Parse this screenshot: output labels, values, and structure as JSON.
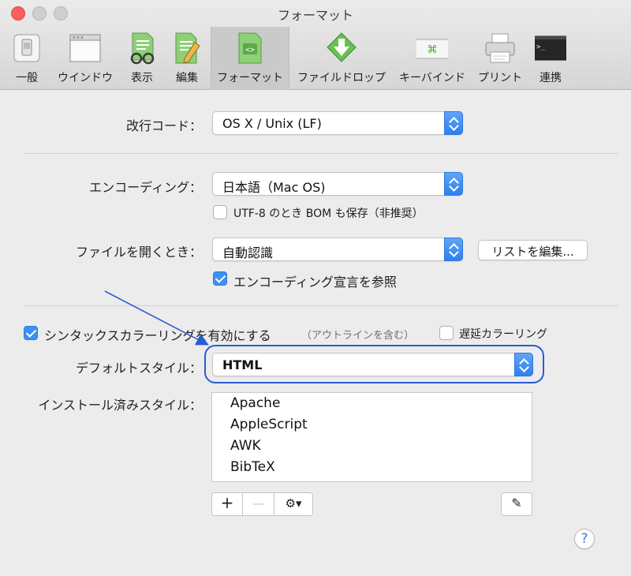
{
  "window": {
    "title": "フォーマット"
  },
  "toolbar": {
    "items": [
      {
        "label": "一般",
        "icon": "general-icon"
      },
      {
        "label": "ウインドウ",
        "icon": "window-icon"
      },
      {
        "label": "表示",
        "icon": "view-icon"
      },
      {
        "label": "編集",
        "icon": "edit-icon"
      },
      {
        "label": "フォーマット",
        "icon": "format-icon",
        "selected": true
      },
      {
        "label": "ファイルドロップ",
        "icon": "file-drop-icon"
      },
      {
        "label": "キーバインド",
        "icon": "key-binding-icon"
      },
      {
        "label": "プリント",
        "icon": "print-icon"
      },
      {
        "label": "連携",
        "icon": "terminal-icon"
      }
    ],
    "key_glyph": "⌘",
    "terminal_prompt": ">_"
  },
  "line_ending": {
    "label": "改行コード：",
    "value": "OS X / Unix (LF)"
  },
  "encoding": {
    "label": "エンコーディング：",
    "value": "日本語（Mac OS)",
    "bom_label": "UTF-8 のとき BOM も保存（非推奨）",
    "bom_checked": false
  },
  "open_file": {
    "label": "ファイルを開くとき：",
    "value": "自動認識",
    "edit_list_button": "リストを編集...",
    "declaration_label": "エンコーディング宣言を参照",
    "declaration_checked": true
  },
  "syntax": {
    "enable_label": "シンタックスカラーリングを有効にする",
    "enable_checked": true,
    "outline_note": "（アウトラインを含む）",
    "delay_label": "遅延カラーリング",
    "delay_checked": false,
    "default_style_label": "デフォルトスタイル：",
    "default_style_value": "HTML",
    "installed_label": "インストール済みスタイル：",
    "installed_styles": [
      "Apache",
      "AppleScript",
      "AWK",
      "BibTeX"
    ]
  },
  "list_controls": {
    "add": "+",
    "remove": "—",
    "action": "⚙▾",
    "edit": "✎"
  },
  "help": "?",
  "colors": {
    "accent": "#3d8ff3",
    "annotation": "#2a5bd6"
  }
}
